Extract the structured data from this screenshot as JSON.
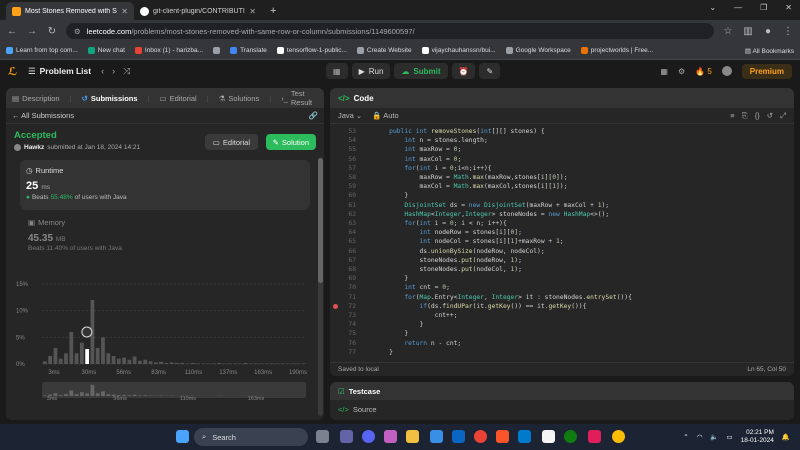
{
  "browser": {
    "tabs": [
      {
        "title": "Most Stones Removed with Sam",
        "active": true,
        "color": "#ffa116"
      },
      {
        "title": "git-client-plugin/CONTRIBUTIN",
        "active": false,
        "color": "#ffffff"
      }
    ],
    "new_tab": "+",
    "url_domain": "leetcode.com",
    "url_path": "/problems/most-stones-removed-with-same-row-or-column/submissions/1149600597/",
    "bookmarks": [
      {
        "label": "Learn from top com...",
        "color": "#4aa3ff"
      },
      {
        "label": "New chat",
        "color": "#10a37f"
      },
      {
        "label": "Inbox (1) - harizba...",
        "color": "#ea4335"
      },
      {
        "label": "",
        "color": "#9aa0a6"
      },
      {
        "label": "Translate",
        "color": "#4285f4"
      },
      {
        "label": "tensorflow-1-public...",
        "color": "#ffffff"
      },
      {
        "label": "Create Website",
        "color": "#9aa0a6"
      },
      {
        "label": "vijaychauhanssn/bui...",
        "color": "#ffffff"
      },
      {
        "label": "Google Workspace",
        "color": "#9aa0a6"
      },
      {
        "label": "projectworlds | Free...",
        "color": "#e8710a"
      }
    ],
    "all_bookmarks": "All Bookmarks"
  },
  "header": {
    "problem_list": "Problem List",
    "run": "Run",
    "submit": "Submit",
    "streak": "5",
    "premium": "Premium"
  },
  "left": {
    "tabs": [
      "Description",
      "Submissions",
      "Editorial",
      "Solutions",
      "Test Result"
    ],
    "all_submissions": "All Submissions",
    "status": "Accepted",
    "user": "Hawkz",
    "submitted": "submitted at Jan 18, 2024 14:21",
    "editorial_btn": "Editorial",
    "solution_btn": "Solution",
    "runtime_label": "Runtime",
    "runtime_value": "25",
    "runtime_unit": "ms",
    "runtime_beats_pre": "Beats",
    "runtime_beats_pct": "55.48%",
    "runtime_beats_post": "of users with Java",
    "memory_label": "Memory",
    "memory_value": "45.35",
    "memory_unit": "MB",
    "memory_beats": "Beats 11.40% of users with Java"
  },
  "chart_data": {
    "type": "bar",
    "yticks": [
      "15%",
      "10%",
      "5%",
      "0%"
    ],
    "xticks": [
      "3ms",
      "30ms",
      "56ms",
      "83ms",
      "110ms",
      "137ms",
      "163ms",
      "190ms"
    ],
    "overview_ticks": [
      "3ms",
      "56ms",
      "110ms",
      "163ms"
    ],
    "ylim": [
      0,
      15
    ],
    "highlight_index": 8,
    "values": [
      0.5,
      1.5,
      3,
      1,
      2,
      6,
      2,
      4,
      2.8,
      12,
      3,
      5,
      2,
      1.5,
      1,
      1.2,
      0.8,
      1.4,
      0.6,
      0.8,
      0.5,
      0.3,
      0.4,
      0.2,
      0.3,
      0.2,
      0.2,
      0.1,
      0.2,
      0.1,
      0.1,
      0.1,
      0.1,
      0.2,
      0.1,
      0.1,
      0.1,
      0.1,
      0.2,
      0.1,
      0.1,
      0.1,
      0.1,
      0.1,
      0.1,
      0.1,
      0.1,
      0.1,
      0.1,
      0.1
    ]
  },
  "code": {
    "title": "Code",
    "lang": "Java",
    "mode": "Auto",
    "saved": "Saved to local",
    "cursor": "Ln 65, Col 50",
    "lines": [
      {
        "n": "53",
        "t": "    public int removeStones(int[][] stones) {"
      },
      {
        "n": "54",
        "t": "        int n = stones.length;"
      },
      {
        "n": "55",
        "t": "        int maxRow = 0;"
      },
      {
        "n": "56",
        "t": "        int maxCol = 0;"
      },
      {
        "n": "57",
        "t": "        for(int i = 0;i<n;i++){"
      },
      {
        "n": "58",
        "t": "            maxRow = Math.max(maxRow,stones[i][0]);"
      },
      {
        "n": "59",
        "t": "            maxCol = Math.max(maxCol,stones[i][1]);"
      },
      {
        "n": "60",
        "t": "        }"
      },
      {
        "n": "61",
        "t": "        DisjointSet ds = new DisjointSet(maxRow + maxCol + 1);"
      },
      {
        "n": "62",
        "t": "        HashMap<Integer,Integer> stoneNodes = new HashMap<>();"
      },
      {
        "n": "63",
        "t": "        for(int i = 0; i < n; i++){"
      },
      {
        "n": "64",
        "t": "            int nodeRow = stones[i][0];"
      },
      {
        "n": "65",
        "t": "            int nodeCol = stones[i][1]+maxRow + 1;"
      },
      {
        "n": "66",
        "t": "            ds.unionBySize(nodeRow, nodeCol);"
      },
      {
        "n": "67",
        "t": "            stoneNodes.put(nodeRow, 1);"
      },
      {
        "n": "68",
        "t": "            stoneNodes.put(nodeCol, 1);"
      },
      {
        "n": "69",
        "t": "        }"
      },
      {
        "n": "70",
        "t": "        int cnt = 0;"
      },
      {
        "n": "71",
        "t": "        for(Map.Entry<Integer, Integer> it : stoneNodes.entrySet()){"
      },
      {
        "n": "72",
        "t": "            if(ds.findUPar(it.getKey()) == it.getKey()){"
      },
      {
        "n": "73",
        "t": "                cnt++;"
      },
      {
        "n": "74",
        "t": "            }"
      },
      {
        "n": "75",
        "t": "        }"
      },
      {
        "n": "76",
        "t": "        return n - cnt;"
      },
      {
        "n": "77",
        "t": "    }"
      }
    ],
    "breakpoint_line": "72"
  },
  "testcase": {
    "title": "Testcase",
    "source": "Source"
  },
  "taskbar": {
    "search": "Search",
    "time": "02:21 PM",
    "date": "18-01-2024",
    "lang": "ENG IN"
  }
}
